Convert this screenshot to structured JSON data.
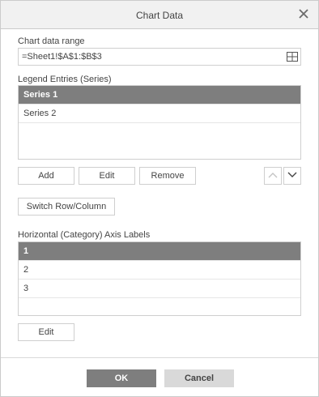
{
  "dialog": {
    "title": "Chart Data"
  },
  "data_range": {
    "label": "Chart data range",
    "value": "=Sheet1!$A$1:$B$3"
  },
  "legend": {
    "label": "Legend Entries (Series)",
    "items": [
      {
        "label": "Series 1",
        "selected": true
      },
      {
        "label": "Series 2",
        "selected": false
      }
    ],
    "add_label": "Add",
    "edit_label": "Edit",
    "remove_label": "Remove"
  },
  "switch_label": "Switch Row/Column",
  "axis": {
    "label": "Horizontal (Category) Axis Labels",
    "items": [
      {
        "label": "1",
        "selected": true
      },
      {
        "label": "2",
        "selected": false
      },
      {
        "label": "3",
        "selected": false
      }
    ],
    "edit_label": "Edit"
  },
  "footer": {
    "ok_label": "OK",
    "cancel_label": "Cancel"
  },
  "icons": {
    "close": "close-icon",
    "range": "grid-icon",
    "up": "chevron-up-icon",
    "down": "chevron-down-icon"
  }
}
